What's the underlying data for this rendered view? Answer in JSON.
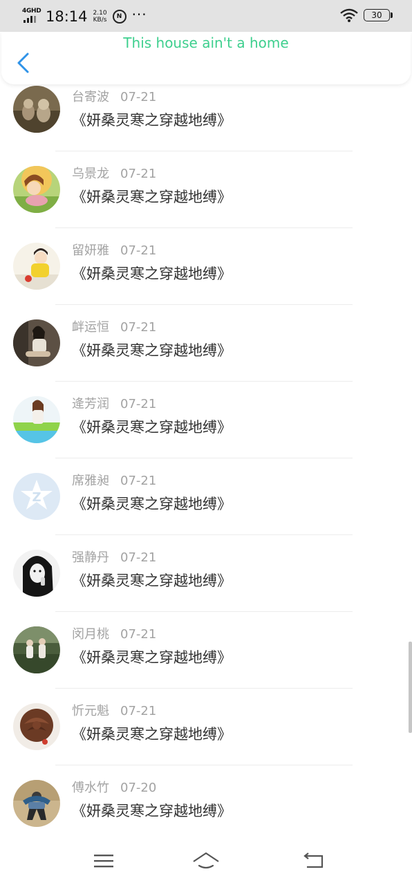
{
  "status_bar": {
    "network": "4GHD",
    "time": "18:14",
    "speed_value": "2.10",
    "speed_unit": "KB/s",
    "badge": "N",
    "more": "···",
    "battery": "30"
  },
  "header": {
    "title": "This house ain't a home",
    "back_icon": "chevron-left-icon"
  },
  "colors": {
    "accent_title": "#3ecf8e",
    "back_arrow": "#2f93e8",
    "name_date_text": "#a3a3a3",
    "book_text": "#333333"
  },
  "items": [
    {
      "name": "台寄波",
      "date": "07-21",
      "book": "《妍桑灵寒之穿越地缚》",
      "avatar": "cats-photo"
    },
    {
      "name": "乌景龙",
      "date": "07-21",
      "book": "《妍桑灵寒之穿越地缚》",
      "avatar": "cartoon-girl"
    },
    {
      "name": "留妍雅",
      "date": "07-21",
      "book": "《妍桑灵寒之穿越地缚》",
      "avatar": "girl-yellow"
    },
    {
      "name": "衅运恒",
      "date": "07-21",
      "book": "《妍桑灵寒之穿越地缚》",
      "avatar": "woman-sitting"
    },
    {
      "name": "逄芳润",
      "date": "07-21",
      "book": "《妍桑灵寒之穿越地缚》",
      "avatar": "girl-field"
    },
    {
      "name": "席雅昶",
      "date": "07-21",
      "book": "《妍桑灵寒之穿越地缚》",
      "avatar": "default-z-logo"
    },
    {
      "name": "强静丹",
      "date": "07-21",
      "book": "《妍桑灵寒之穿越地缚》",
      "avatar": "bw-girl"
    },
    {
      "name": "闵月桃",
      "date": "07-21",
      "book": "《妍桑灵寒之穿越地缚》",
      "avatar": "couple-field"
    },
    {
      "name": "忻元魁",
      "date": "07-21",
      "book": "《妍桑灵寒之穿越地缚》",
      "avatar": "chocolate-rose"
    },
    {
      "name": "傅水竹",
      "date": "07-20",
      "book": "《妍桑灵寒之穿越地缚》",
      "avatar": "dancer-pose"
    }
  ],
  "navbar": {
    "menu_icon": "menu-icon",
    "home_icon": "home-icon",
    "back_icon": "return-icon"
  }
}
